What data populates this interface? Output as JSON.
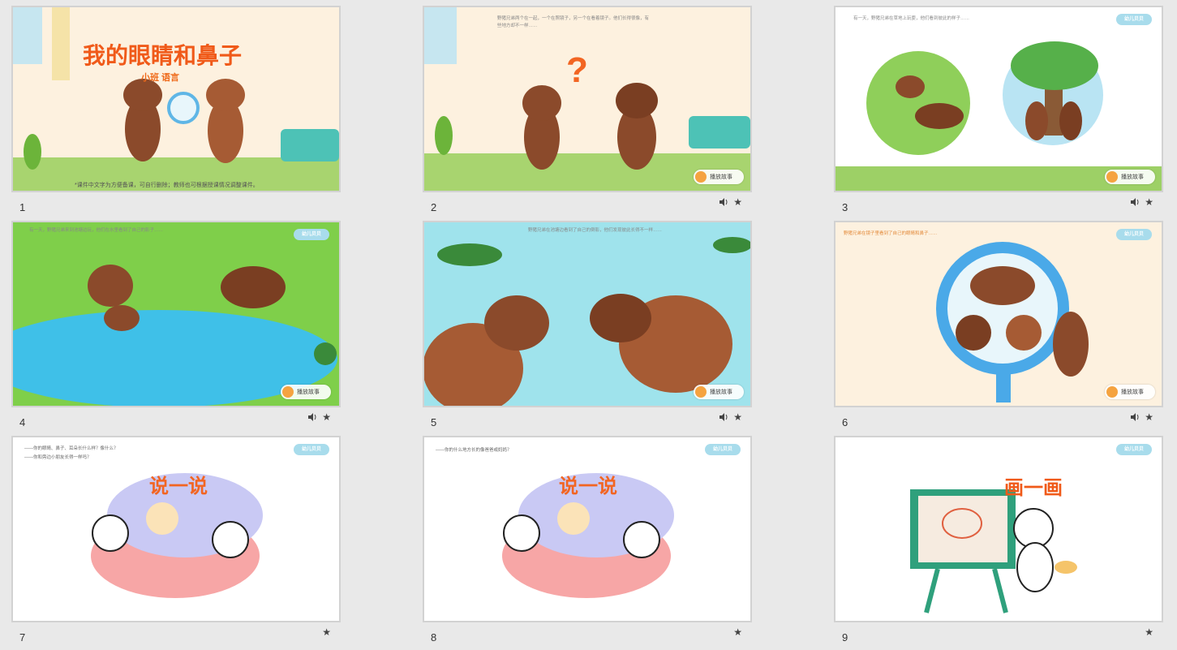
{
  "slides": [
    {
      "number": "1",
      "title": "我的眼睛和鼻子",
      "subtitle": "小班 语言",
      "note": "*课件中文字为方便备课，可自行删除；教师也可根据授课情况调整课件。"
    },
    {
      "number": "2",
      "button": "播放故事",
      "text": "野猪兄弟两个在一起，一个在照镜子，另一个在看着镜子。他们长得很像，有些地方却不一样……"
    },
    {
      "number": "3",
      "button": "播放故事",
      "text": "有一天，野猪兄弟在草地上玩耍，他们看到彼此的样子……"
    },
    {
      "number": "4",
      "button": "播放故事",
      "text": "有一天，野猪兄弟来到池塘边玩，他们在水里看到了自己的影子……"
    },
    {
      "number": "5",
      "button": "播放故事",
      "text": "野猪兄弟在池塘边看到了自己的倒影，他们发现彼此长得不一样……"
    },
    {
      "number": "6",
      "button": "播放故事",
      "text": "野猪兄弟在镜子里看到了自己的眼睛和鼻子……"
    },
    {
      "number": "7",
      "heading": "说一说",
      "lines": [
        "——你的眼睛、鼻子、耳朵长什么样？像什么？",
        "——你和旁边小朋友长得一样吗？"
      ]
    },
    {
      "number": "8",
      "heading": "说一说",
      "lines": [
        "——你的什么地方长的像爸爸或妈妈？"
      ]
    },
    {
      "number": "9",
      "heading": "画一画"
    }
  ],
  "logo": "幼儿贝贝",
  "icons": {
    "sound": "speaker-icon",
    "animation": "star-icon"
  }
}
